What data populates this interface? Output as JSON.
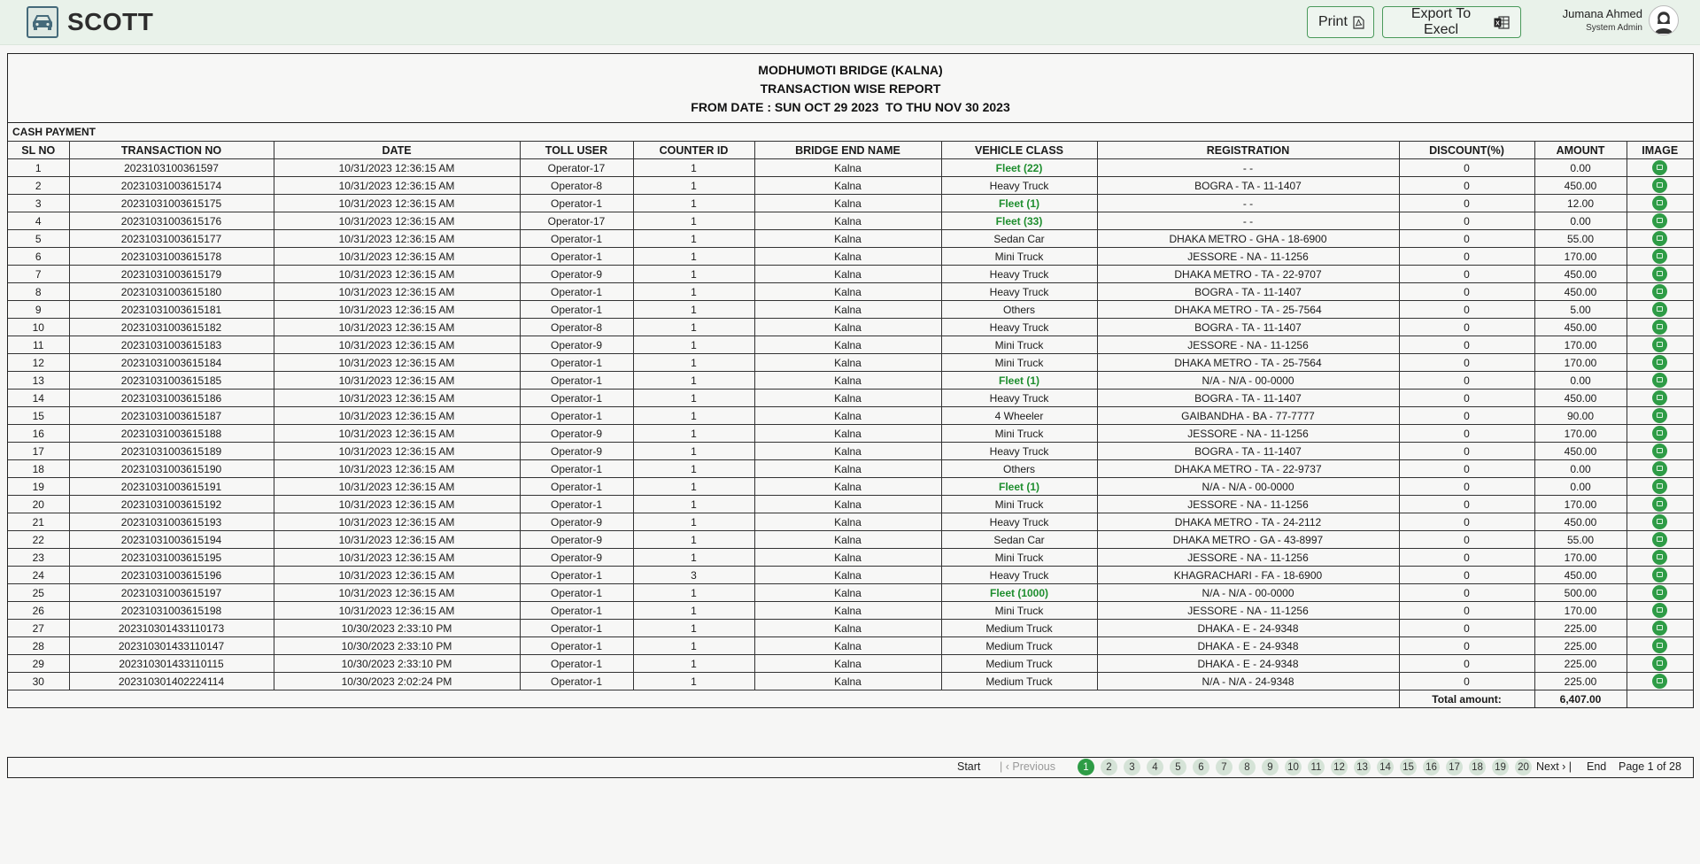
{
  "app": {
    "brand": "SCOTT",
    "print_label": "Print",
    "export_label": "Export To Execl",
    "user_name": "Jumana Ahmed",
    "user_role": "System Admin"
  },
  "report": {
    "title1": "MODHUMOTI BRIDGE (KALNA)",
    "title2": "TRANSACTION WISE REPORT",
    "title3": "FROM DATE : SUN OCT 29 2023  TO THU NOV 30 2023",
    "section": "CASH PAYMENT",
    "columns": [
      "SL NO",
      "TRANSACTION NO",
      "DATE",
      "TOLL USER",
      "COUNTER ID",
      "BRIDGE END NAME",
      "VEHICLE CLASS",
      "REGISTRATION",
      "DISCOUNT(%)",
      "AMOUNT",
      "IMAGE"
    ],
    "rows": [
      [
        "1",
        "2023103100361597",
        "10/31/2023  12:36:15 AM",
        "Operator-17",
        "1",
        "Kalna",
        "Fleet (22)",
        "- -",
        "0",
        "0.00"
      ],
      [
        "2",
        "20231031003615174",
        "10/31/2023  12:36:15 AM",
        "Operator-8",
        "1",
        "Kalna",
        "Heavy Truck",
        "BOGRA - TA - 11-1407",
        "0",
        "450.00"
      ],
      [
        "3",
        "20231031003615175",
        "10/31/2023  12:36:15 AM",
        "Operator-1",
        "1",
        "Kalna",
        "Fleet (1)",
        "- -",
        "0",
        "12.00"
      ],
      [
        "4",
        "20231031003615176",
        "10/31/2023  12:36:15 AM",
        "Operator-17",
        "1",
        "Kalna",
        "Fleet (33)",
        "- -",
        "0",
        "0.00"
      ],
      [
        "5",
        "20231031003615177",
        "10/31/2023  12:36:15 AM",
        "Operator-1",
        "1",
        "Kalna",
        "Sedan Car",
        "DHAKA METRO - GHA - 18-6900",
        "0",
        "55.00"
      ],
      [
        "6",
        "20231031003615178",
        "10/31/2023  12:36:15 AM",
        "Operator-1",
        "1",
        "Kalna",
        "Mini Truck",
        "JESSORE - NA - 11-1256",
        "0",
        "170.00"
      ],
      [
        "7",
        "20231031003615179",
        "10/31/2023  12:36:15 AM",
        "Operator-9",
        "1",
        "Kalna",
        "Heavy Truck",
        "DHAKA METRO - TA - 22-9707",
        "0",
        "450.00"
      ],
      [
        "8",
        "20231031003615180",
        "10/31/2023  12:36:15 AM",
        "Operator-1",
        "1",
        "Kalna",
        "Heavy Truck",
        "BOGRA - TA - 11-1407",
        "0",
        "450.00"
      ],
      [
        "9",
        "20231031003615181",
        "10/31/2023  12:36:15 AM",
        "Operator-1",
        "1",
        "Kalna",
        "Others",
        "DHAKA METRO - TA - 25-7564",
        "0",
        "5.00"
      ],
      [
        "10",
        "20231031003615182",
        "10/31/2023  12:36:15 AM",
        "Operator-8",
        "1",
        "Kalna",
        "Heavy Truck",
        "BOGRA - TA - 11-1407",
        "0",
        "450.00"
      ],
      [
        "11",
        "20231031003615183",
        "10/31/2023  12:36:15 AM",
        "Operator-9",
        "1",
        "Kalna",
        "Mini Truck",
        "JESSORE - NA - 11-1256",
        "0",
        "170.00"
      ],
      [
        "12",
        "20231031003615184",
        "10/31/2023  12:36:15 AM",
        "Operator-1",
        "1",
        "Kalna",
        "Mini Truck",
        "DHAKA METRO - TA - 25-7564",
        "0",
        "170.00"
      ],
      [
        "13",
        "20231031003615185",
        "10/31/2023  12:36:15 AM",
        "Operator-1",
        "1",
        "Kalna",
        "Fleet (1)",
        "N/A - N/A - 00-0000",
        "0",
        "0.00"
      ],
      [
        "14",
        "20231031003615186",
        "10/31/2023  12:36:15 AM",
        "Operator-1",
        "1",
        "Kalna",
        "Heavy Truck",
        "BOGRA - TA - 11-1407",
        "0",
        "450.00"
      ],
      [
        "15",
        "20231031003615187",
        "10/31/2023  12:36:15 AM",
        "Operator-1",
        "1",
        "Kalna",
        "4 Wheeler",
        "GAIBANDHA - BA - 77-7777",
        "0",
        "90.00"
      ],
      [
        "16",
        "20231031003615188",
        "10/31/2023  12:36:15 AM",
        "Operator-9",
        "1",
        "Kalna",
        "Mini Truck",
        "JESSORE - NA - 11-1256",
        "0",
        "170.00"
      ],
      [
        "17",
        "20231031003615189",
        "10/31/2023  12:36:15 AM",
        "Operator-9",
        "1",
        "Kalna",
        "Heavy Truck",
        "BOGRA - TA - 11-1407",
        "0",
        "450.00"
      ],
      [
        "18",
        "20231031003615190",
        "10/31/2023  12:36:15 AM",
        "Operator-1",
        "1",
        "Kalna",
        "Others",
        "DHAKA METRO - TA - 22-9737",
        "0",
        "0.00"
      ],
      [
        "19",
        "20231031003615191",
        "10/31/2023  12:36:15 AM",
        "Operator-1",
        "1",
        "Kalna",
        "Fleet (1)",
        "N/A - N/A - 00-0000",
        "0",
        "0.00"
      ],
      [
        "20",
        "20231031003615192",
        "10/31/2023  12:36:15 AM",
        "Operator-1",
        "1",
        "Kalna",
        "Mini Truck",
        "JESSORE - NA - 11-1256",
        "0",
        "170.00"
      ],
      [
        "21",
        "20231031003615193",
        "10/31/2023  12:36:15 AM",
        "Operator-9",
        "1",
        "Kalna",
        "Heavy Truck",
        "DHAKA METRO - TA - 24-2112",
        "0",
        "450.00"
      ],
      [
        "22",
        "20231031003615194",
        "10/31/2023  12:36:15 AM",
        "Operator-9",
        "1",
        "Kalna",
        "Sedan Car",
        "DHAKA METRO - GA - 43-8997",
        "0",
        "55.00"
      ],
      [
        "23",
        "20231031003615195",
        "10/31/2023  12:36:15 AM",
        "Operator-9",
        "1",
        "Kalna",
        "Mini Truck",
        "JESSORE - NA - 11-1256",
        "0",
        "170.00"
      ],
      [
        "24",
        "20231031003615196",
        "10/31/2023  12:36:15 AM",
        "Operator-1",
        "3",
        "Kalna",
        "Heavy Truck",
        "KHAGRACHARI - FA - 18-6900",
        "0",
        "450.00"
      ],
      [
        "25",
        "20231031003615197",
        "10/31/2023  12:36:15 AM",
        "Operator-1",
        "1",
        "Kalna",
        "Fleet (1000)",
        "N/A - N/A - 00-0000",
        "0",
        "500.00"
      ],
      [
        "26",
        "20231031003615198",
        "10/31/2023  12:36:15 AM",
        "Operator-1",
        "1",
        "Kalna",
        "Mini Truck",
        "JESSORE - NA - 11-1256",
        "0",
        "170.00"
      ],
      [
        "27",
        "202310301433110173",
        "10/30/2023  2:33:10 PM",
        "Operator-1",
        "1",
        "Kalna",
        "Medium Truck",
        "DHAKA - E - 24-9348",
        "0",
        "225.00"
      ],
      [
        "28",
        "202310301433110147",
        "10/30/2023  2:33:10 PM",
        "Operator-1",
        "1",
        "Kalna",
        "Medium Truck",
        "DHAKA - E - 24-9348",
        "0",
        "225.00"
      ],
      [
        "29",
        "202310301433110115",
        "10/30/2023  2:33:10 PM",
        "Operator-1",
        "1",
        "Kalna",
        "Medium Truck",
        "DHAKA - E - 24-9348",
        "0",
        "225.00"
      ],
      [
        "30",
        "202310301402224114",
        "10/30/2023  2:02:24 PM",
        "Operator-1",
        "1",
        "Kalna",
        "Medium Truck",
        "N/A - N/A - 24-9348",
        "0",
        "225.00"
      ]
    ],
    "total_label": "Total amount:",
    "total_value": "6,407.00"
  },
  "pager": {
    "start": "Start",
    "previous": "| ‹ Previous",
    "pages": [
      "1",
      "2",
      "3",
      "4",
      "5",
      "6",
      "7",
      "8",
      "9",
      "10",
      "11",
      "12",
      "13",
      "14",
      "15",
      "16",
      "17",
      "18",
      "19",
      "20"
    ],
    "active_page": "1",
    "next": "Next › |",
    "end": "End",
    "page_info": "Page 1 of 28"
  },
  "colors": {
    "accent": "#2e9c46",
    "fleet": "#1e8e2e",
    "topbar": "#e9f2ea"
  },
  "icons": {
    "logo": "car-icon",
    "print": "pdf-icon",
    "export": "excel-icon",
    "avatar": "user-avatar-icon",
    "image": "image-icon"
  }
}
